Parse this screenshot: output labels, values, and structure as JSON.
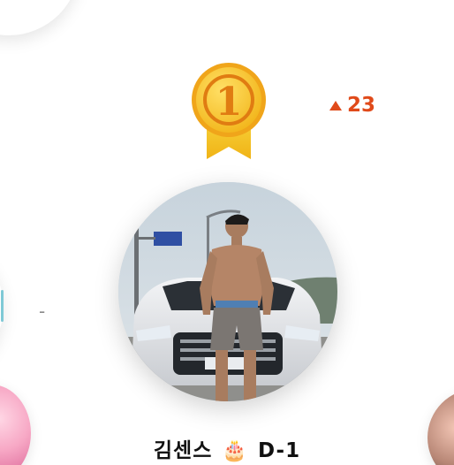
{
  "ranking": {
    "medal_number": "1",
    "rank_change": "23",
    "side_marker": "-",
    "user_name": "김센스",
    "badge_icon": "birthday-cake-icon",
    "badge_text": "D-1"
  },
  "colors": {
    "medal_gold": "#f5c518",
    "rank_up": "#e04a1a",
    "name_text": "#111111"
  }
}
